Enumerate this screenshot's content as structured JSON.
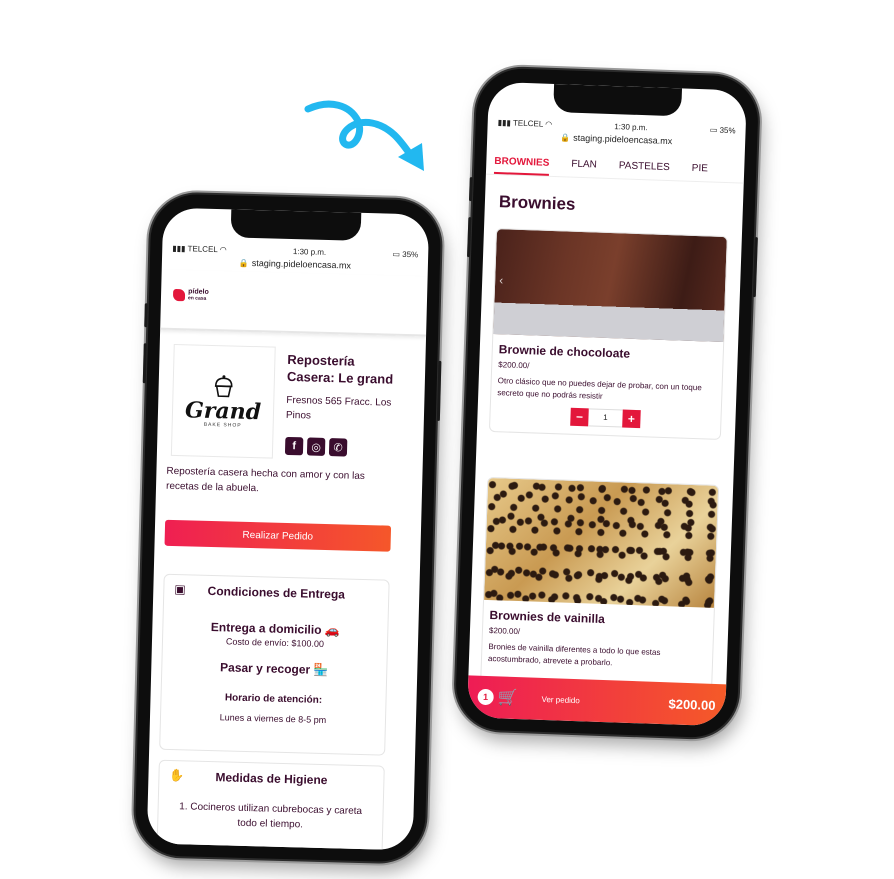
{
  "status": {
    "carrier": "TELCEL",
    "time": "1:30 p.m.",
    "battery": "35%"
  },
  "phone1": {
    "url": "staging.pideloencasa.mx",
    "brand": {
      "line1": "pídelo",
      "line2": "en casa"
    },
    "store": {
      "logo_text": "Grand",
      "logo_sub": "BAKE SHOP",
      "name": "Repostería Casera: Le grand",
      "address": "Fresnos 565 Fracc. Los Pinos",
      "description": "Repostería casera hecha con amor y con las recetas de la abuela."
    },
    "order_button": "Realizar Pedido",
    "delivery": {
      "title": "Condiciones de Entrega",
      "home_delivery": "Entrega a domicilio",
      "shipping_cost": "Costo de envío: $100.00",
      "pickup": "Pasar y recoger",
      "hours_title": "Horario de atención:",
      "hours": "Lunes a viernes de 8-5 pm"
    },
    "hygiene": {
      "title": "Medidas de Higiene",
      "item1": "1. Cocineros utilizan cubrebocas y careta todo el tiempo."
    }
  },
  "phone2": {
    "url": "staging.pideloencasa.mx",
    "tabs": [
      "BROWNIES",
      "FLAN",
      "PASTELES",
      "PIE"
    ],
    "section_title": "Brownies",
    "products": [
      {
        "name": "Brownie de chocoloate",
        "price": "$200.00/",
        "description": "Otro clásico que no puedes dejar de probar, con un toque secreto que no podrás resistir",
        "quantity": "1"
      },
      {
        "name": "Brownies de vainilla",
        "price": "$200.00/",
        "description": "Bronies de vainilla diferentes a todo lo que estas acostumbrado, atrevete a probarlo."
      }
    ],
    "cart": {
      "count": "1",
      "label": "Ver pedido",
      "total": "$200.00"
    }
  },
  "colors": {
    "accent": "#e3173b",
    "text": "#3a0d2e",
    "arrow": "#22b8f0"
  },
  "icons": [
    "lock-icon",
    "wifi-icon",
    "cupcake-icon",
    "facebook-icon",
    "whatsapp-icon",
    "phone-icon",
    "calendar-icon",
    "car-icon",
    "store-icon",
    "hygiene-icon",
    "cart-icon",
    "curved-arrow-icon"
  ]
}
